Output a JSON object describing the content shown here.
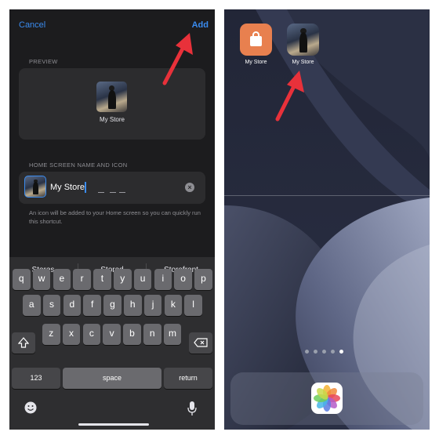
{
  "left": {
    "nav": {
      "cancel": "Cancel",
      "add": "Add"
    },
    "preview": {
      "section_label": "PREVIEW",
      "icon_label": "My Store"
    },
    "name_section": {
      "section_label": "HOME SCREEN NAME AND ICON",
      "input_value": "My Store",
      "hint": "An icon will be added to your Home screen so you can quickly run this shortcut."
    },
    "suggestions": [
      "Stores",
      "Stored",
      "Storefront"
    ],
    "keyboard": {
      "row1": [
        "q",
        "w",
        "e",
        "r",
        "t",
        "y",
        "u",
        "i",
        "o",
        "p"
      ],
      "row2": [
        "a",
        "s",
        "d",
        "f",
        "g",
        "h",
        "j",
        "k",
        "l"
      ],
      "row3": [
        "z",
        "x",
        "c",
        "v",
        "b",
        "n",
        "m"
      ],
      "numbers": "123",
      "space": "space",
      "return": "return"
    },
    "icons": {
      "shift": "shift-icon",
      "delete": "delete-icon",
      "emoji": "emoji-icon",
      "mic": "microphone-icon",
      "clear": "clear-icon"
    }
  },
  "right": {
    "apps": [
      {
        "label": "My Store",
        "icon": "shopping-bag-icon"
      },
      {
        "label": "My Store",
        "icon": "photo-thumbnail-icon"
      }
    ],
    "page_dots": {
      "count": 5,
      "active_index": 4
    },
    "dock": [
      {
        "icon": "photos-icon"
      }
    ]
  },
  "colors": {
    "accent": "#3a8cf0",
    "arrow": "#e8313a",
    "panel_dark": "#1c1c1e",
    "keys": "#6a6a6e"
  }
}
